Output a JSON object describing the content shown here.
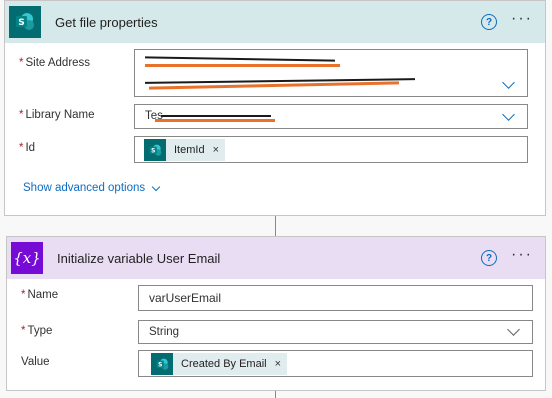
{
  "sp_action": {
    "title": "Get file properties",
    "site_address": {
      "label": "Site Address",
      "required": "*"
    },
    "library_name": {
      "label": "Library Name",
      "required": "*",
      "value_prefix": "Tes"
    },
    "id": {
      "label": "Id",
      "required": "*",
      "token": "ItemId",
      "token_remove": "×"
    },
    "show_advanced": "Show advanced options",
    "help": "?",
    "more": "···"
  },
  "var_action": {
    "title": "Initialize variable User Email",
    "name": {
      "label": "Name",
      "required": "*",
      "value": "varUserEmail"
    },
    "type": {
      "label": "Type",
      "required": "*",
      "value": "String"
    },
    "value": {
      "label": "Value",
      "token": "Created By Email",
      "token_remove": "×"
    },
    "help": "?",
    "more": "···"
  },
  "colors": {
    "sharepoint": "#036c70",
    "variable": "#770bd6",
    "link": "#0f6cbd"
  },
  "icons": {
    "sp_header": "sharepoint-icon",
    "var_header": "variable-icon"
  }
}
